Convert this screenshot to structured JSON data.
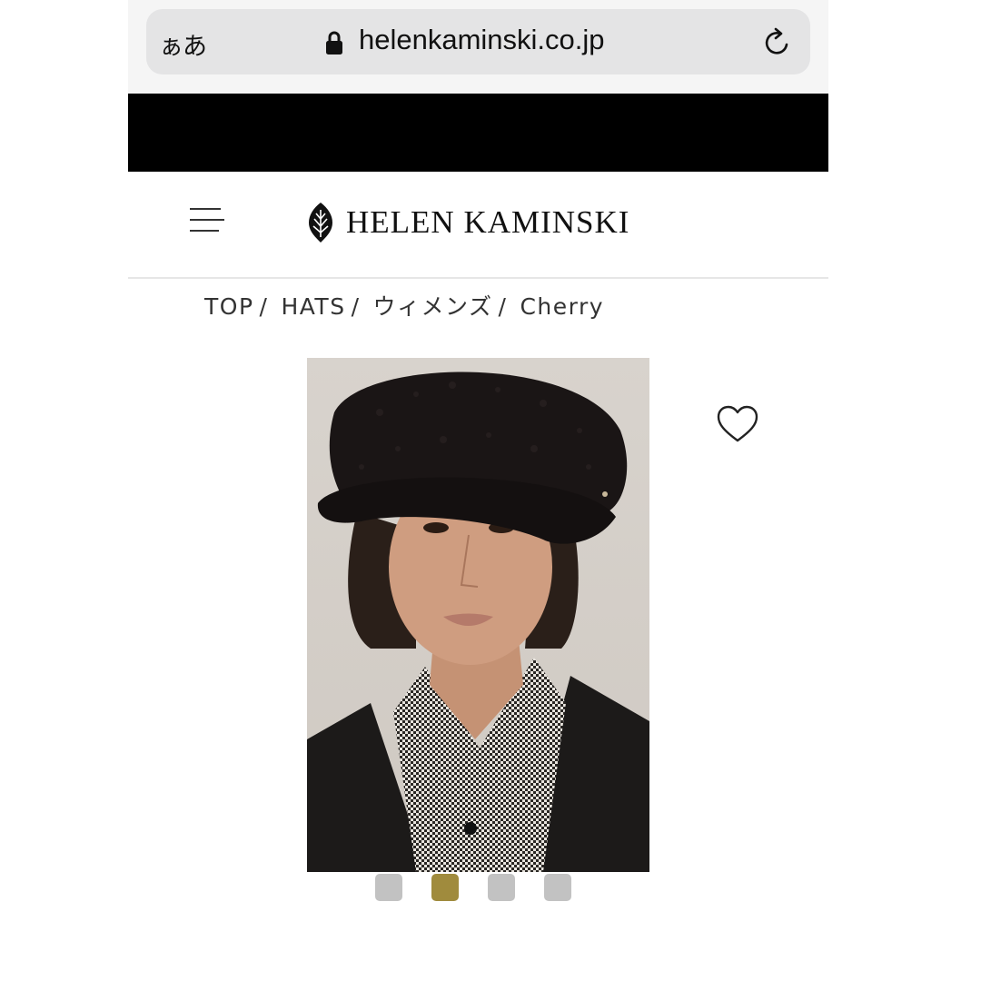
{
  "browser": {
    "text_size_label": "ぁあ",
    "url": "helenkaminski.co.jp",
    "lock_icon": "lock-icon",
    "reload_icon": "reload-icon"
  },
  "header": {
    "menu_icon": "hamburger-menu-icon",
    "brand": "HELEN KAMINSKI",
    "logo_icon": "protea-logo-icon"
  },
  "breadcrumb": {
    "items": [
      "TOP",
      "HATS",
      "ウィメンズ",
      "Cherry"
    ],
    "separator": "/"
  },
  "product": {
    "favorite_icon": "heart-icon",
    "carousel": {
      "total": 4,
      "active_index": 1,
      "active_color": "#a08b3d",
      "inactive_color": "#c2c2c2"
    }
  },
  "colors": {
    "banner": "#000000",
    "browser_bar": "#f5f5f5",
    "url_pill": "#e4e4e5"
  }
}
